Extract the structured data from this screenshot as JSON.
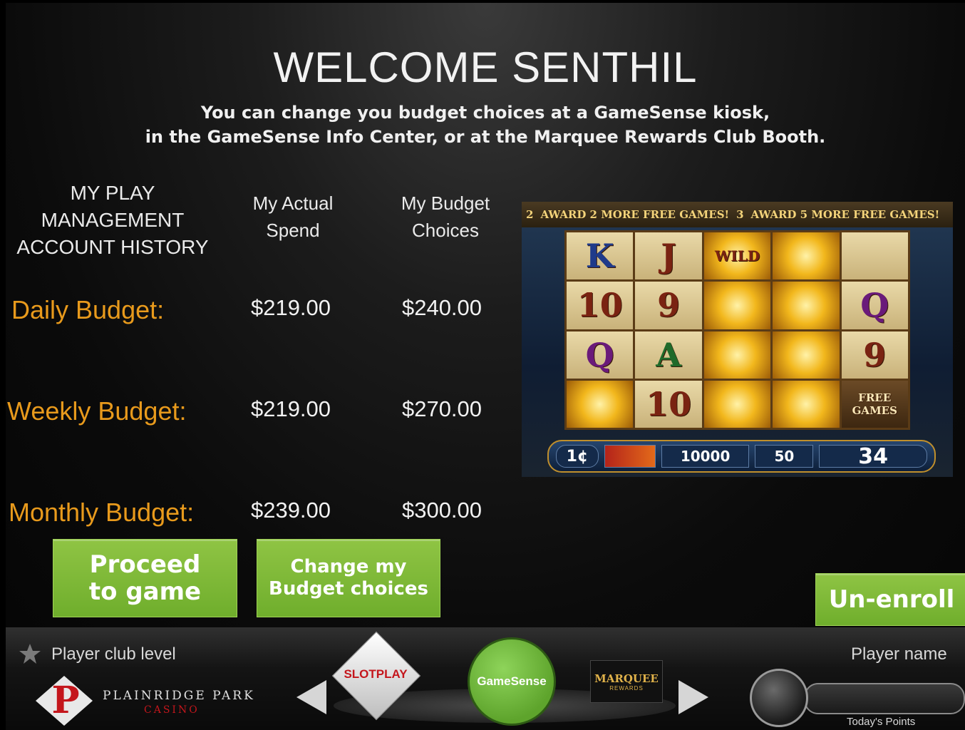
{
  "header": {
    "title": "WELCOME SENTHIL",
    "subtitle_line1": "You can change you budget choices at a GameSense kiosk,",
    "subtitle_line2": "in the GameSense Info Center, or at the Marquee Rewards Club Booth."
  },
  "table": {
    "section_title": [
      "MY PLAY",
      "MANAGEMENT",
      "ACCOUNT HISTORY"
    ],
    "col_actual": [
      "My Actual",
      "Spend"
    ],
    "col_budget": [
      "My Budget",
      "Choices"
    ],
    "rows": [
      {
        "label": "Daily Budget:",
        "actual": "$219.00",
        "budget": "$240.00"
      },
      {
        "label": "Weekly Budget:",
        "actual": "$219.00",
        "budget": "$270.00"
      },
      {
        "label": "Monthly Budget:",
        "actual": "$239.00",
        "budget": "$300.00"
      }
    ]
  },
  "buttons": {
    "proceed": [
      "Proceed",
      "to game"
    ],
    "change": [
      "Change my",
      "Budget choices"
    ],
    "unenroll": "Un-enroll"
  },
  "slot": {
    "banner_left": "2",
    "banner_left_text": "AWARD 2 MORE FREE GAMES!",
    "banner_right": "3",
    "banner_right_text": "AWARD 5 MORE FREE GAMES!",
    "reels": [
      [
        "K",
        "J",
        "WILD",
        "",
        ""
      ],
      [
        "10",
        "9",
        "",
        "",
        "Q"
      ],
      [
        "Q",
        "A",
        "",
        "",
        "9"
      ],
      [
        "",
        "10",
        "",
        "",
        "FREE GAMES"
      ]
    ],
    "denomination": "1¢",
    "credits": "10000",
    "bet": "50",
    "win": "34"
  },
  "bottom": {
    "club_level_label": "Player club level",
    "casino_name": "PLAINRIDGE PARK",
    "casino_sub": "CASINO",
    "slotplay": "SLOTPLAY",
    "gamesense": "GameSense",
    "marquee": "MARQUEE",
    "marquee_sub": "REWARDS",
    "player_name_label": "Player name",
    "todays_points_label": "Today's Points"
  },
  "colors": {
    "accent_orange": "#e89a1c",
    "button_green": "#7cb83a",
    "gamesense_green": "#6dbb3c"
  }
}
